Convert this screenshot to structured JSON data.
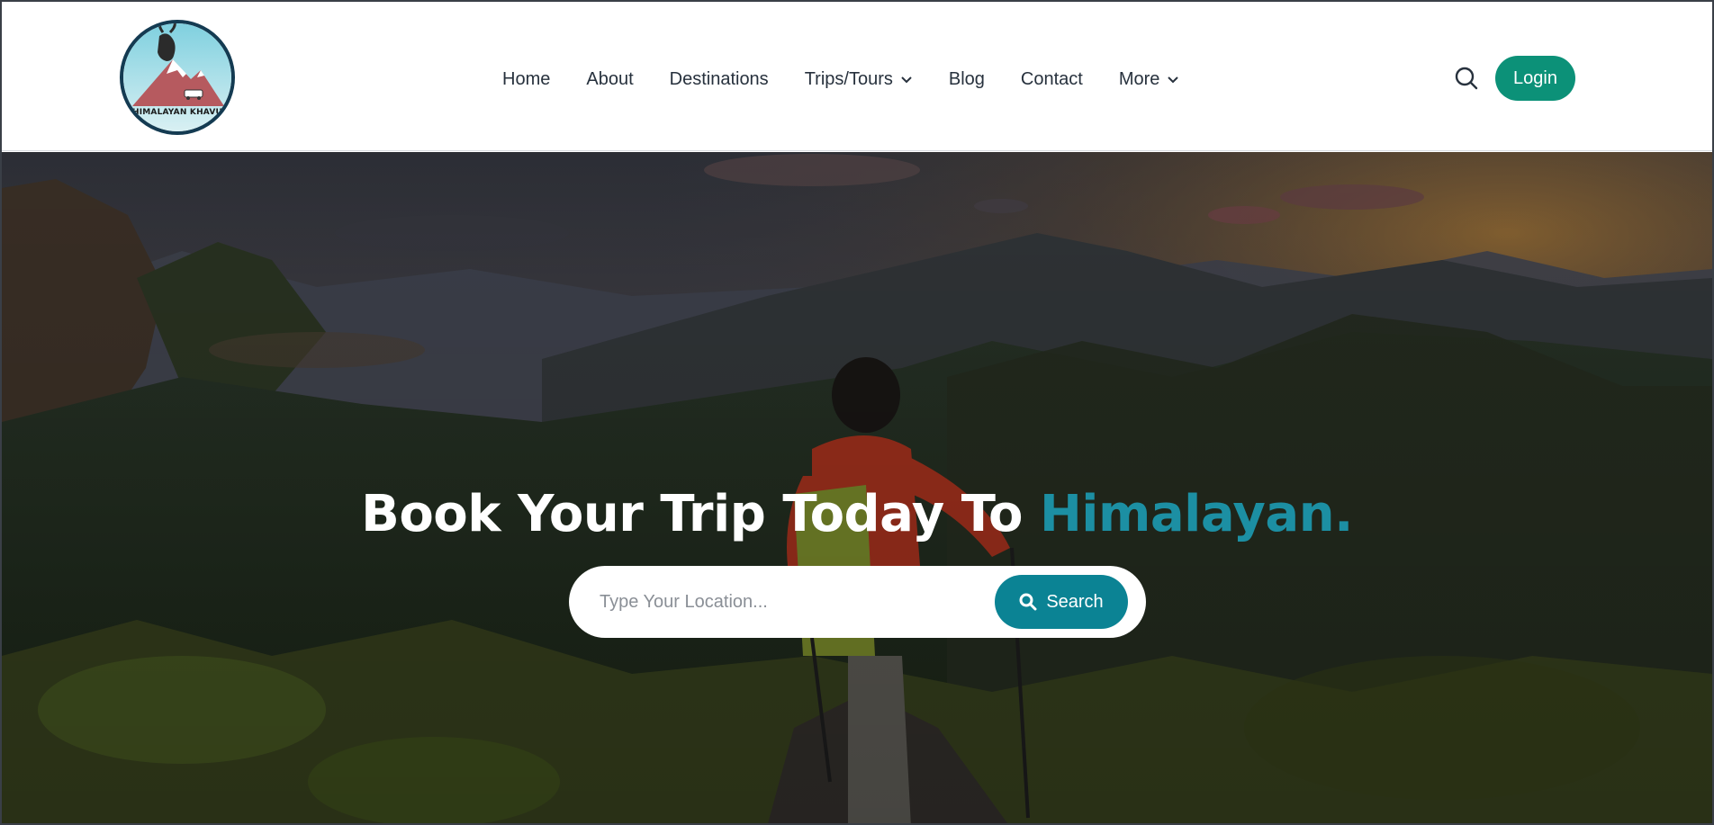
{
  "brand": {
    "logo_text": "HIMALAYAN KHAVU",
    "logo_icon": "goat-mountain-logo"
  },
  "nav": {
    "items": [
      {
        "label": "Home",
        "dropdown": false
      },
      {
        "label": "About",
        "dropdown": false
      },
      {
        "label": "Destinations",
        "dropdown": false
      },
      {
        "label": "Trips/Tours",
        "dropdown": true
      },
      {
        "label": "Blog",
        "dropdown": false
      },
      {
        "label": "Contact",
        "dropdown": false
      },
      {
        "label": "More",
        "dropdown": true
      }
    ],
    "search_icon": "search-icon",
    "login_label": "Login"
  },
  "hero": {
    "title_main": "Book Your Trip Today To ",
    "title_accent": "Himalayan.",
    "search_placeholder": "Type Your Location...",
    "search_button_label": "Search"
  },
  "colors": {
    "accent_teal": "#1c8fa3",
    "login_green": "#0c9178",
    "search_button": "#0b8394",
    "nav_text": "#27313d"
  }
}
